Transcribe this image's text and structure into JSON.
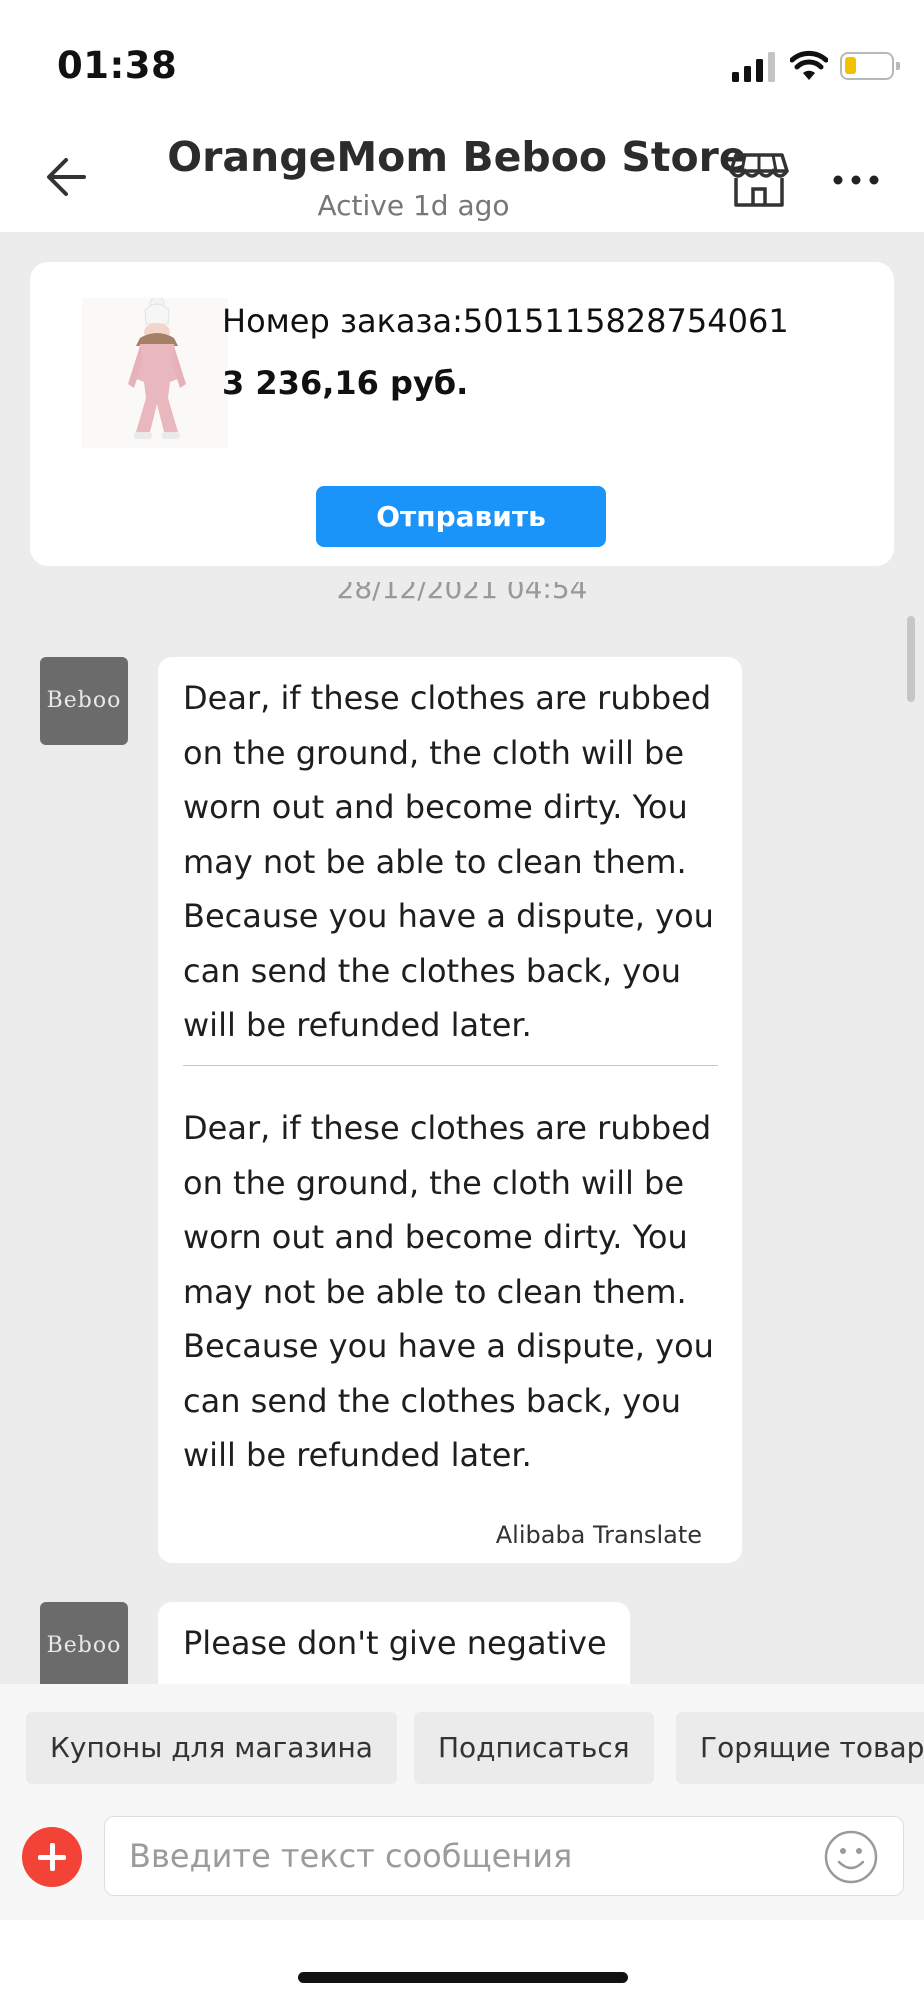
{
  "status_bar": {
    "time": "01:38"
  },
  "header": {
    "store_name": "OrangeMom Beboo Store",
    "active_status": "Active 1d ago"
  },
  "order_card": {
    "order_number": "Номер заказа:5015115828754061",
    "price": "3 236,16 руб.",
    "send_button": "Отправить"
  },
  "chat": {
    "timestamp": "28/12/2021 04:54",
    "messages": [
      {
        "avatar_text": "Beboo",
        "original": "Dear, if these clothes are rubbed on the ground, the cloth will be worn out and become dirty. You may not be able to clean them. Because you have a dispute, you can send the clothes back, you will be refunded later.",
        "translated": "Dear, if these clothes are rubbed on the ground, the cloth will be worn out and become dirty. You may not be able to clean them. Because you have a dispute, you can send the clothes back, you will be refunded later.",
        "translation_credit": "Alibaba Translate"
      },
      {
        "avatar_text": "Beboo",
        "original": "Please don't give negative"
      }
    ]
  },
  "quick_actions": [
    {
      "label": "Купоны для магазина"
    },
    {
      "label": "Подписаться"
    },
    {
      "label": "Горящие товары"
    }
  ],
  "input": {
    "placeholder": "Введите текст сообщения"
  },
  "colors": {
    "accent_blue": "#1a94f8",
    "add_red": "#f24336",
    "battery_yellow": "#f2c200",
    "chat_background": "#ececec",
    "avatar_gray": "#6b6b6b"
  },
  "icons": {
    "back": "arrow-left-icon",
    "store": "storefront-icon",
    "more": "more-horizontal-icon",
    "add": "plus-circle-icon",
    "emoji": "smiley-icon"
  }
}
